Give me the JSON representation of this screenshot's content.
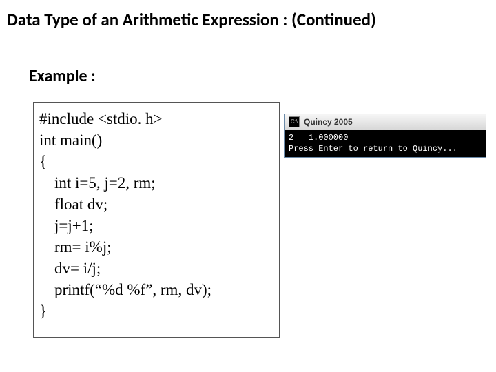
{
  "title": "Data Type of an Arithmetic Expression : (Continued)",
  "subtitle": "Example :",
  "code": {
    "l1": "#include <stdio. h>",
    "l2": "int main()",
    "l3": "{",
    "l4": "int i=5, j=2, rm;",
    "l5": "float dv;",
    "l6": "j=j+1;",
    "l7": "rm= i%j;",
    "l8": "dv= i/j;",
    "l9": "printf(“%d   %f”, rm, dv);",
    "l10": "}"
  },
  "console": {
    "window_title": "Quincy 2005",
    "out1": "2   1.000000",
    "out2": "Press Enter to return to Quincy..."
  }
}
